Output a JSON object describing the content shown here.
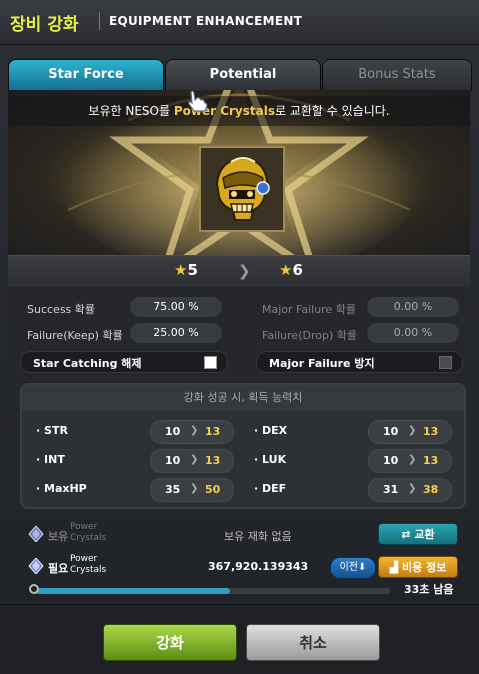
{
  "window": {
    "title_ko": "장비 강화",
    "title_en": "EQUIPMENT ENHANCEMENT"
  },
  "tabs": [
    {
      "label": "Star Force",
      "active": true
    },
    {
      "label": "Potential",
      "active": false
    },
    {
      "label": "Bonus Stats",
      "active": false
    }
  ],
  "banner": {
    "prefix": "보유한 NESO를 ",
    "highlight": "Power Crystals",
    "suffix": "로 교환할 수 있습니다."
  },
  "item": {
    "icon": "golden-helmet-icon"
  },
  "stars": {
    "current": "5",
    "next": "6",
    "star_icon": "star-icon",
    "arrow_icon": "chevron-right-icon"
  },
  "rates": {
    "success_label": "Success 확률",
    "success_value": "75.00 %",
    "failure_keep_label": "Failure(Keep) 확률",
    "failure_keep_value": "25.00 %",
    "major_failure_label": "Major Failure 확률",
    "major_failure_value": "0.00 %",
    "failure_drop_label": "Failure(Drop) 확률",
    "failure_drop_value": "0.00 %"
  },
  "options": {
    "star_catching_label": "Star Catching 해제",
    "star_catching_checked": false,
    "major_failure_prevent_label": "Major Failure 방지",
    "major_failure_prevent_checked": false
  },
  "gains": {
    "header": "강화 성공 시, 획득 능력치",
    "items": [
      {
        "name": "STR",
        "from": "10",
        "to": "13"
      },
      {
        "name": "DEX",
        "from": "10",
        "to": "13"
      },
      {
        "name": "INT",
        "from": "10",
        "to": "13"
      },
      {
        "name": "LUK",
        "from": "10",
        "to": "13"
      },
      {
        "name": "MaxHP",
        "from": "35",
        "to": "50"
      },
      {
        "name": "DEF",
        "from": "31",
        "to": "38"
      }
    ]
  },
  "crystals": {
    "own_tag": "보유",
    "own_name_1": "Power",
    "own_name_2": "Crystals",
    "own_value": "보유 재화 없음",
    "exchange_label": "교환",
    "need_tag": "필요",
    "need_name_1": "Power",
    "need_name_2": "Crystals",
    "need_value": "367,920.139343",
    "prev_label": "이전",
    "cost_label": "비용 정보",
    "icon": "power-crystal-icon"
  },
  "timer": {
    "remaining": "33초 남음",
    "progress": 0.55
  },
  "actions": {
    "enhance_label": "강화",
    "cancel_label": "취소"
  },
  "colors": {
    "accent_tab": "#2fb2d0",
    "highlight": "#f2c94c",
    "enhance_green": "#8cc63f",
    "gain_yellow": "#f3d24e"
  }
}
